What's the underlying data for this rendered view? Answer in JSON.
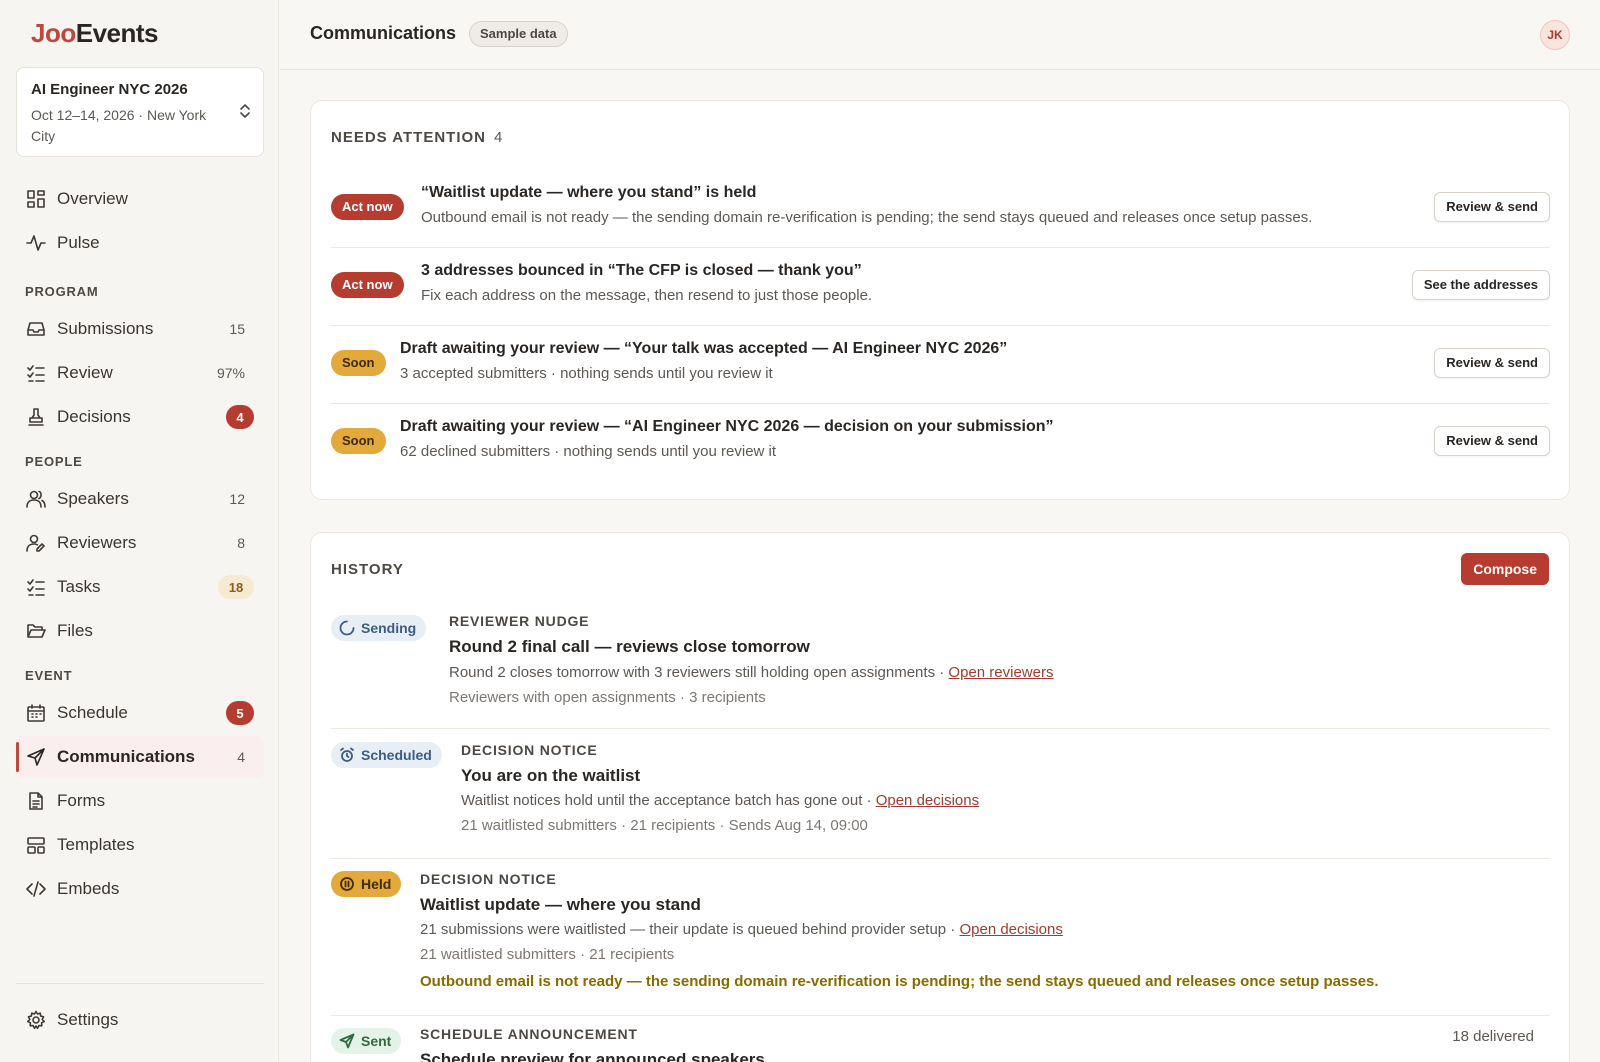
{
  "brand": {
    "part1": "Joo",
    "part2": "Events"
  },
  "event": {
    "name": "AI Engineer NYC 2026",
    "meta": "Oct 12–14, 2026 · New York City"
  },
  "nav": {
    "overview": "Overview",
    "pulse": "Pulse",
    "program_label": "PROGRAM",
    "submissions": {
      "label": "Submissions",
      "count": "15"
    },
    "review": {
      "label": "Review",
      "count": "97%"
    },
    "decisions": {
      "label": "Decisions",
      "count": "4"
    },
    "people_label": "PEOPLE",
    "speakers": {
      "label": "Speakers",
      "count": "12"
    },
    "reviewers": {
      "label": "Reviewers",
      "count": "8"
    },
    "tasks": {
      "label": "Tasks",
      "count": "18"
    },
    "files": "Files",
    "event_label": "EVENT",
    "schedule": {
      "label": "Schedule",
      "count": "5"
    },
    "communications": {
      "label": "Communications",
      "count": "4"
    },
    "forms": "Forms",
    "templates": "Templates",
    "embeds": "Embeds",
    "settings": "Settings"
  },
  "header": {
    "title": "Communications",
    "badge": "Sample data",
    "avatar": "JK"
  },
  "attention": {
    "title": "NEEDS ATTENTION",
    "count": "4",
    "items": [
      {
        "tag": "Act now",
        "title": "“Waitlist update — where you stand” is held",
        "sub": "Outbound email is not ready — the sending domain re-verification is pending; the send stays queued and releases once setup passes.",
        "button": "Review & send"
      },
      {
        "tag": "Act now",
        "title": "3 addresses bounced in “The CFP is closed — thank you”",
        "sub": "Fix each address on the message, then resend to just those people.",
        "button": "See the addresses"
      },
      {
        "tag": "Soon",
        "title": "Draft awaiting your review — “Your talk was accepted — AI Engineer NYC 2026”",
        "sub": "3 accepted submitters · nothing sends until you review it",
        "button": "Review & send"
      },
      {
        "tag": "Soon",
        "title": "Draft awaiting your review — “AI Engineer NYC 2026 — decision on your submission”",
        "sub": "62 declined submitters · nothing sends until you review it",
        "button": "Review & send"
      }
    ]
  },
  "history": {
    "title": "HISTORY",
    "compose": "Compose",
    "items": [
      {
        "status": "Sending",
        "kind": "REVIEWER NUDGE",
        "title": "Round 2 final call — reviews close tomorrow",
        "desc": "Round 2 closes tomorrow with 3 reviewers still holding open assignments · ",
        "link": "Open reviewers",
        "meta": "Reviewers with open assignments · 3 recipients"
      },
      {
        "status": "Scheduled",
        "kind": "DECISION NOTICE",
        "title": "You are on the waitlist",
        "desc": "Waitlist notices hold until the acceptance batch has gone out · ",
        "link": "Open decisions",
        "meta": "21 waitlisted submitters · 21 recipients · Sends Aug 14, 09:00"
      },
      {
        "status": "Held",
        "kind": "DECISION NOTICE",
        "title": "Waitlist update — where you stand",
        "desc": "21 submissions were waitlisted — their update is queued behind provider setup · ",
        "link": "Open decisions",
        "meta": "21 waitlisted submitters · 21 recipients",
        "warning": "Outbound email is not ready — the sending domain re-verification is pending; the send stays queued and releases once setup passes."
      },
      {
        "status": "Sent",
        "kind": "SCHEDULE ANNOUNCEMENT",
        "title": "Schedule preview for announced speakers",
        "right": "18 delivered"
      }
    ]
  },
  "colors": {
    "accent": "#b63c30",
    "amber": "#e3a93a",
    "link": "#a33b30"
  }
}
